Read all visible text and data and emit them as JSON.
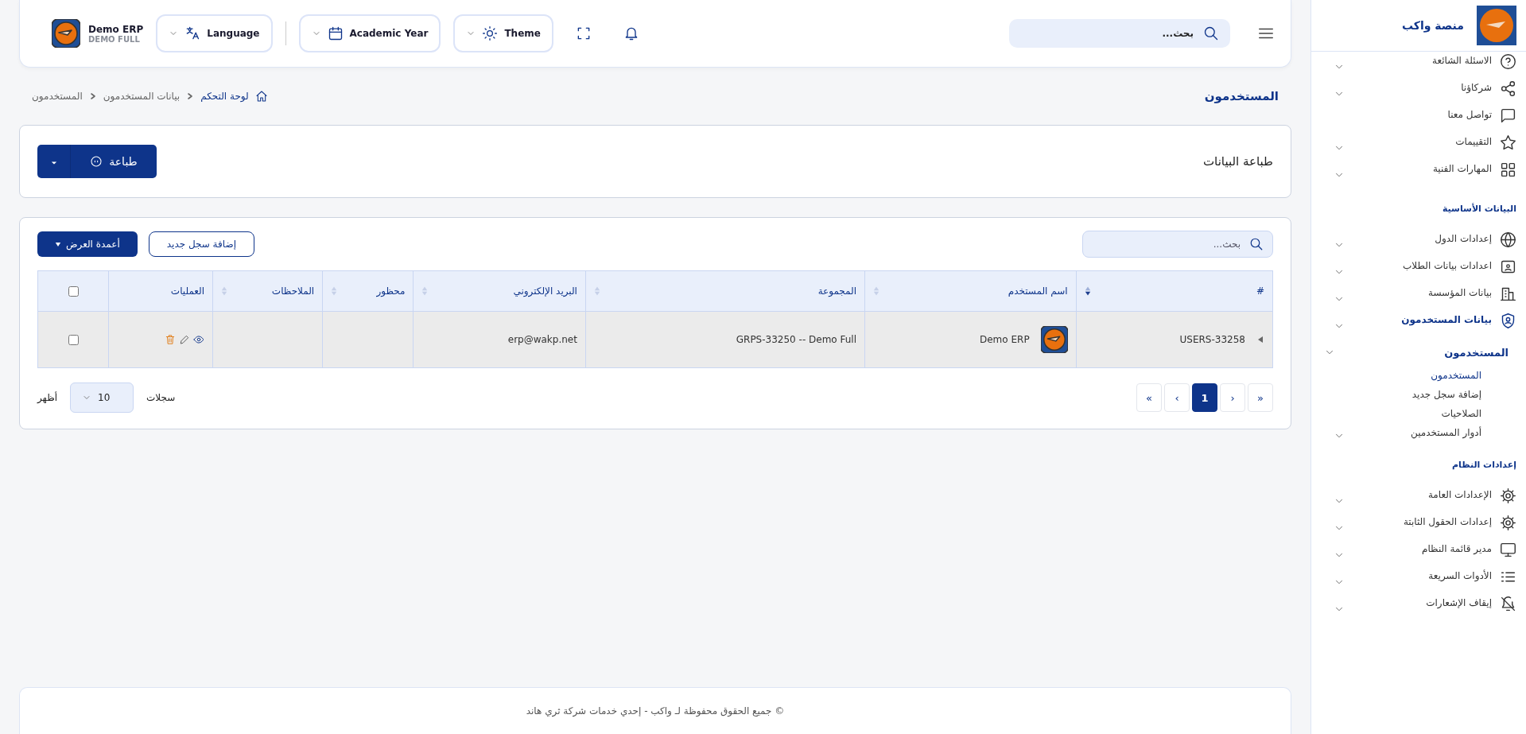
{
  "topbar": {
    "brand": {
      "name": "Demo ERP",
      "subtitle": "DEMO FULL"
    },
    "selectors": [
      {
        "label": "Theme"
      },
      {
        "label": "Academic Year"
      },
      {
        "label": "Language"
      }
    ],
    "search": {
      "placeholder": "بحث..."
    }
  },
  "page": {
    "title": "المستخدمون",
    "breadcrumb": [
      {
        "label": "لوحة التحكم"
      },
      {
        "label": "بيانات المستخدمون"
      },
      {
        "label": "المستخدمون"
      }
    ]
  },
  "print_card": {
    "title": "طباعة البيانات",
    "button": "طباعة"
  },
  "table_card": {
    "search": {
      "placeholder": "بحث..."
    },
    "add_button": "إضافة سجل جديد",
    "columns_button": "أعمدة العرض",
    "columns": [
      {
        "label": "#",
        "sortable": true,
        "sorted": true
      },
      {
        "label": "اسم المستخدم",
        "sortable": true,
        "sorted": false
      },
      {
        "label": "المجموعة",
        "sortable": true,
        "sorted": false
      },
      {
        "label": "البريد الإلكتروني",
        "sortable": true,
        "sorted": false
      },
      {
        "label": "محظور",
        "sortable": true,
        "sorted": false
      },
      {
        "label": "الملاحظات",
        "sortable": true,
        "sorted": false
      },
      {
        "label": "العمليات",
        "sortable": false,
        "sorted": false
      }
    ],
    "header_checked": false,
    "rows": [
      {
        "id": "USERS-33258",
        "name": "Demo ERP",
        "group": "GRPS-33250 -- Demo Full",
        "email": "erp@wakp.net",
        "banned": "",
        "notes": "",
        "checked": false
      }
    ],
    "pagination": [
      {
        "label": "«",
        "selected": false
      },
      {
        "label": "‹",
        "selected": false
      },
      {
        "label": "1",
        "selected": true
      },
      {
        "label": "›",
        "selected": false
      },
      {
        "label": "»",
        "selected": false
      }
    ],
    "page_size": {
      "prefix": "أظهر",
      "value": "10",
      "suffix": "سجلات"
    }
  },
  "footer": "© جميع الحقوق محفوظة لـ واكب - إحدي خدمات شركة ثري هاند",
  "sidebar": {
    "title": "منصة واكب",
    "sections": [
      {
        "items": [
          {
            "label": "الاسئلة الشائعة",
            "expandable": true,
            "selected": false
          },
          {
            "label": "شركاؤنا",
            "expandable": true,
            "selected": false
          },
          {
            "label": "تواصل معنا",
            "expandable": false,
            "selected": false
          },
          {
            "label": "التقييمات",
            "expandable": true,
            "selected": false
          },
          {
            "label": "المهارات الفنية",
            "expandable": true,
            "selected": false
          }
        ]
      },
      {
        "title": "البيانات الأساسية",
        "items": [
          {
            "label": "إعدادات الدول",
            "expandable": true,
            "selected": false
          },
          {
            "label": "اعدادات بيانات الطلاب",
            "expandable": true,
            "selected": false
          },
          {
            "label": "بيانات المؤسسة",
            "expandable": true,
            "selected": false
          },
          {
            "label": "بيانات المستخدمون",
            "expandable": true,
            "selected": true,
            "children": [
              {
                "label": "المستخدمون",
                "expanded": true,
                "children": [
                  {
                    "label": "المستخدمون",
                    "selected": true,
                    "expandable": false
                  },
                  {
                    "label": "إضافة سجل جديد",
                    "selected": false,
                    "expandable": false
                  },
                  {
                    "label": "الصلاحيات",
                    "selected": false,
                    "expandable": false
                  },
                  {
                    "label": "أدوار المستخدمين",
                    "selected": false,
                    "expandable": true
                  }
                ]
              }
            ]
          }
        ]
      },
      {
        "title": "إعدادات النظام",
        "items": [
          {
            "label": "الإعدادات العامة",
            "expandable": true,
            "selected": false
          },
          {
            "label": "إعدادات الحقول الثابتة",
            "expandable": true,
            "selected": false
          },
          {
            "label": "مدير قائمة النظام",
            "expandable": true,
            "selected": false
          },
          {
            "label": "الأدوات السريعة",
            "expandable": true,
            "selected": false
          },
          {
            "label": "إيقاف الإشعارات",
            "expandable": true,
            "selected": false
          }
        ]
      }
    ]
  }
}
